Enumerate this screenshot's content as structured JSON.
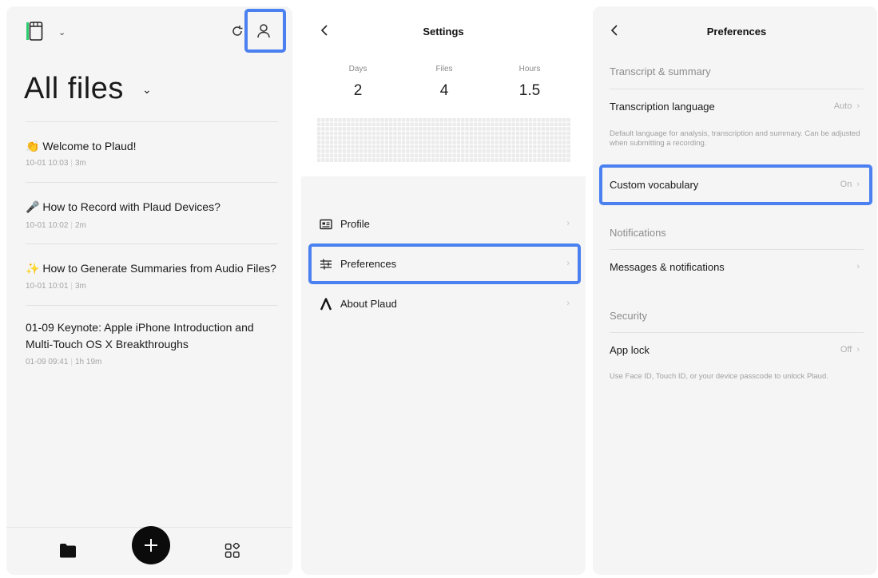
{
  "files_screen": {
    "title": "All files",
    "files": [
      {
        "emoji": "👏",
        "title": "Welcome to Plaud!",
        "date": "10-01 10:03",
        "duration": "3m"
      },
      {
        "emoji": "🎤",
        "title": "How to Record with Plaud Devices?",
        "date": "10-01 10:02",
        "duration": "2m"
      },
      {
        "emoji": "✨",
        "title": "How to Generate Summaries from Audio Files?",
        "date": "10-01 10:01",
        "duration": "3m"
      },
      {
        "emoji": "",
        "title": "01-09 Keynote: Apple iPhone Introduction and Multi-Touch OS X Breakthroughs",
        "date": "01-09 09:41",
        "duration": "1h 19m"
      }
    ],
    "icons": {
      "app": "app-logo-icon",
      "sync": "sync-icon",
      "profile": "profile-icon",
      "files_tab": "folder-icon",
      "add": "plus-icon",
      "apps_tab": "apps-grid-icon"
    }
  },
  "settings_screen": {
    "title": "Settings",
    "stats": [
      {
        "label": "Days",
        "value": "2"
      },
      {
        "label": "Files",
        "value": "4"
      },
      {
        "label": "Hours",
        "value": "1.5"
      }
    ],
    "menu": [
      {
        "label": "Profile",
        "icon": "id-card-icon"
      },
      {
        "label": "Preferences",
        "icon": "sliders-icon"
      },
      {
        "label": "About Plaud",
        "icon": "plaud-logo-icon"
      }
    ]
  },
  "preferences_screen": {
    "title": "Preferences",
    "section_transcript": "Transcript & summary",
    "transcription_language": {
      "label": "Transcription language",
      "value": "Auto"
    },
    "transcription_desc": "Default language for analysis, transcription and summary. Can be adjusted when submitting a recording.",
    "custom_vocabulary": {
      "label": "Custom vocabulary",
      "value": "On"
    },
    "section_notifications": "Notifications",
    "messages": {
      "label": "Messages & notifications"
    },
    "section_security": "Security",
    "app_lock": {
      "label": "App lock",
      "value": "Off"
    },
    "app_lock_desc": "Use Face ID, Touch ID, or your device passcode to unlock Plaud."
  },
  "colors": {
    "highlight": "#4a80f0",
    "accent_green": "#2ecc71"
  }
}
